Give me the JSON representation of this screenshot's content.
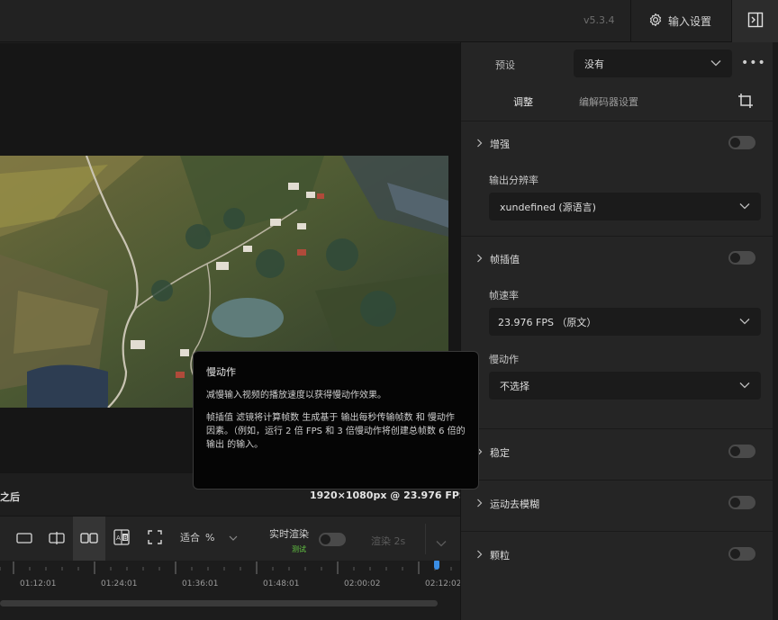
{
  "app": {
    "version": "v5.3.4",
    "input_settings_label": "输入设置"
  },
  "preview": {
    "after_label": "之后",
    "resolution": "1920×1080px @ 23.976 FPS"
  },
  "toolbar": {
    "fit_label": "适合",
    "fit_unit": "%",
    "realtime_label": "实时渲染",
    "beta_label": "测试",
    "render_label": "渲染 2s"
  },
  "timeline": {
    "ticks": [
      "01:12:01",
      "01:24:01",
      "01:36:01",
      "01:48:01",
      "02:00:02",
      "02:12:02"
    ]
  },
  "panel": {
    "preset_label": "预设",
    "preset_value": "没有",
    "tabs": {
      "adjust": "调整",
      "codec": "编解码器设置"
    },
    "enhance": {
      "title": "增强",
      "output_resolution_label": "输出分辨率",
      "output_resolution_value": "xundefined (源语言)"
    },
    "interpolation": {
      "title": "帧插值",
      "frame_rate_label": "帧速率",
      "frame_rate_value": "23.976 FPS （原文）",
      "slowmo_label": "慢动作",
      "slowmo_value": "不选择"
    },
    "stabilize": {
      "title": "稳定"
    },
    "motion_deblur": {
      "title": "运动去模糊"
    },
    "grain": {
      "title": "颗粒"
    }
  },
  "tooltip": {
    "title": "慢动作",
    "line1": "减慢输入视频的播放速度以获得慢动作效果。",
    "body": "帧插值 滤镜将计算帧数 生成基于 输出每秒传输帧数 和 慢动作 因素。（例如，运行 2 倍 FPS 和 3 倍慢动作将创建总帧数 6 倍的输出 的输入。"
  },
  "colors": {
    "accent": "#3a8ee6",
    "beta": "#66cc44",
    "panel_bg": "#252525",
    "field_bg": "#1b1b1b"
  },
  "icons": [
    "gear-icon",
    "sidebar-toggle-icon",
    "chevron-down-icon",
    "more-icon",
    "crop-icon",
    "chevron-right-icon",
    "single-view-icon",
    "split-view-icon",
    "side-by-side-icon",
    "compare-ab-icon",
    "fullscreen-icon"
  ]
}
